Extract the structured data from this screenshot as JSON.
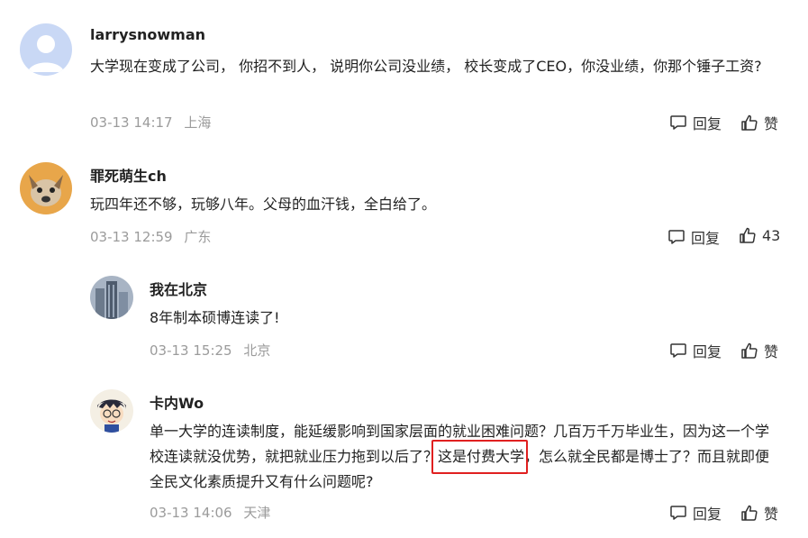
{
  "comments": [
    {
      "username": "larrysnowman",
      "text": "大学现在变成了公司， 你招不到人， 说明你公司没业绩， 校长变成了CEO，你没业绩，你那个锤子工资?",
      "date": "03-13 14:17",
      "location": "上海",
      "reply_label": "回复",
      "like_label": "赞",
      "avatar_icon": "default-avatar-icon"
    },
    {
      "username": "罪死萌生ch",
      "text": "玩四年还不够，玩够八年。父母的血汗钱，全白给了。",
      "date": "03-13 12:59",
      "location": "广东",
      "reply_label": "回复",
      "like_label": "43",
      "avatar_icon": "dog-avatar-icon"
    },
    {
      "username": "我在北京",
      "text": "8年制本硕博连读了!",
      "date": "03-13 15:25",
      "location": "北京",
      "reply_label": "回复",
      "like_label": "赞",
      "avatar_icon": "building-avatar-icon"
    },
    {
      "username": "卡内Wo",
      "text_part1": "单一大学的连读制度，能延缓影响到国家层面的就业困难问题？几百万千万毕业生，因为这一个学校连读就没优势，就把就业压力拖到以后了？",
      "text_highlight": "这是付费大学",
      "text_part2": "，怎么就全民都是博士了？而且就即便全民文化素质提升又有什么问题呢?",
      "date": "03-13 14:06",
      "location": "天津",
      "reply_label": "回复",
      "like_label": "赞",
      "avatar_icon": "cartoon-avatar-icon"
    }
  ],
  "colors": {
    "meta": "#9b9b9b",
    "highlight_border": "#e02020",
    "default_avatar_bg": "#c9d8f5"
  }
}
